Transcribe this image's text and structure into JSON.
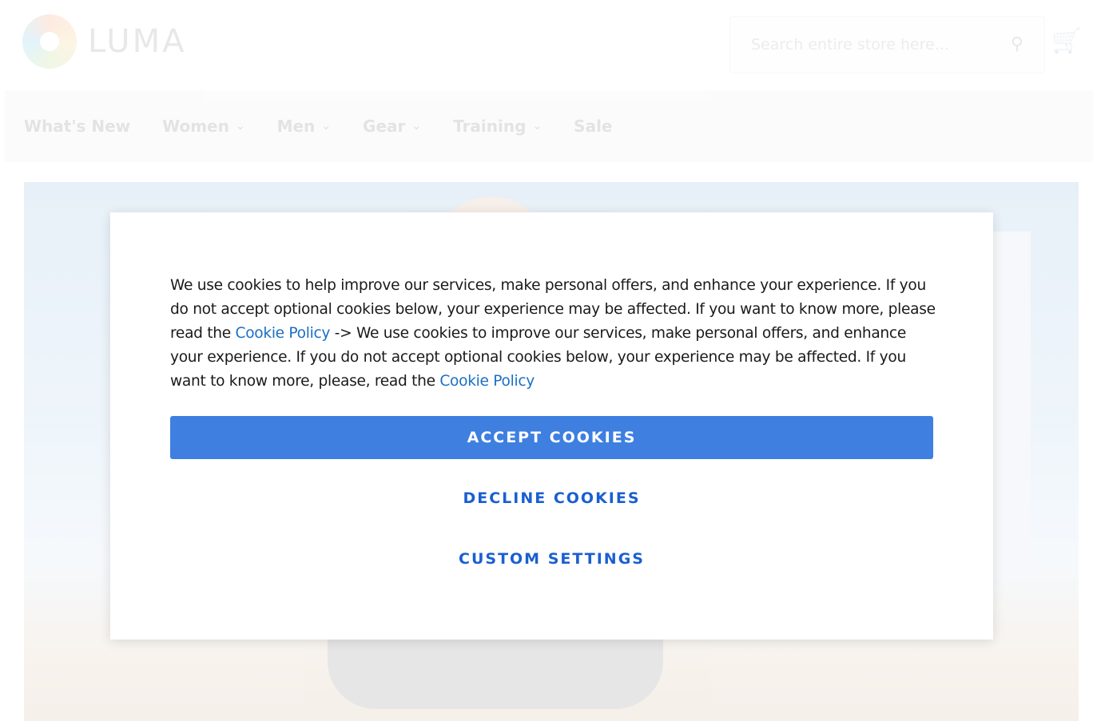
{
  "header": {
    "logo_text": "LUMA",
    "search": {
      "placeholder": "Search entire store here..."
    }
  },
  "nav": {
    "items": [
      {
        "label": "What's New",
        "has_dropdown": false
      },
      {
        "label": "Women",
        "has_dropdown": true
      },
      {
        "label": "Men",
        "has_dropdown": true
      },
      {
        "label": "Gear",
        "has_dropdown": true
      },
      {
        "label": "Training",
        "has_dropdown": true
      },
      {
        "label": "Sale",
        "has_dropdown": false
      }
    ]
  },
  "cookie_modal": {
    "text_part1": "We use cookies to help improve our services, make personal offers, and enhance your experience. If you do not accept optional cookies below, your experience may be affected. If you want to know more, please read the ",
    "link1": "Cookie Policy",
    "text_part2": " -> We use cookies to improve our services, make personal offers, and enhance your experience. If you do not accept optional cookies below, your experience may be affected. If you want to know more, please, read the ",
    "link2": "Cookie Policy",
    "accept_label": "ACCEPT COOKIES",
    "decline_label": "DECLINE COOKIES",
    "custom_label": "CUSTOM SETTINGS"
  },
  "colors": {
    "accept_button": "#3e7fe0",
    "link": "#1a6fc4"
  }
}
